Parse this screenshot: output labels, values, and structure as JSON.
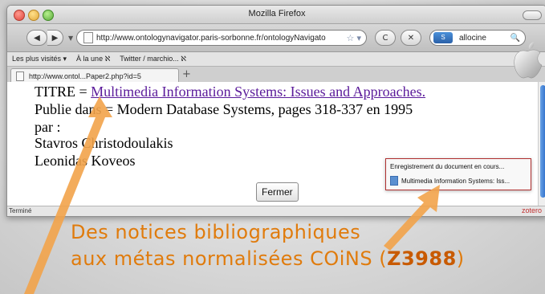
{
  "window": {
    "title": "Mozilla Firefox",
    "back_label": "◀",
    "forward_label": "▶",
    "menu_arrow": "▼",
    "url": "http://www.ontologynavigator.paris-sorbonne.fr/ontologyNavigato",
    "bookmark_star": "☆ ▾",
    "reload_label": "C",
    "stop_label": "✕",
    "search_engine_label": "S",
    "search_value": "allocine",
    "search_icon": "🔍",
    "home_icon": "⌂"
  },
  "bookmarks_bar": {
    "items": [
      "Les plus visités ▾",
      "À la une ℵ",
      "Twitter / marchio... ℵ"
    ]
  },
  "tabs": {
    "active": "http://www.ontol...Paper2.php?id=5",
    "new_tab": "+"
  },
  "content": {
    "titre_prefix": "TITRE = ",
    "titre_link": "Multimedia Information Systems: Issues and Approaches.",
    "publie": "Publie dans = Modern Database Systems, pages 318-337 en 1995",
    "par": "par :",
    "author1": "Stavros Christodoulakis",
    "author2": "Leonidas Koveos",
    "close_button": "Fermer"
  },
  "statusbar": {
    "left": "Terminé",
    "right": "zotero"
  },
  "zotero_popup": {
    "title": "Enregistrement du document en cours...",
    "item": "Multimedia Information Systems: Iss..."
  },
  "caption": {
    "line1": "Des notices bibliographiques",
    "line2_prefix": "aux métas normalisées COiNS (",
    "line2_code": "Z3988",
    "line2_suffix": ")"
  },
  "colors": {
    "caption": "#e07b0c",
    "link": "#5a1a9a",
    "popup_border": "#b03030"
  }
}
